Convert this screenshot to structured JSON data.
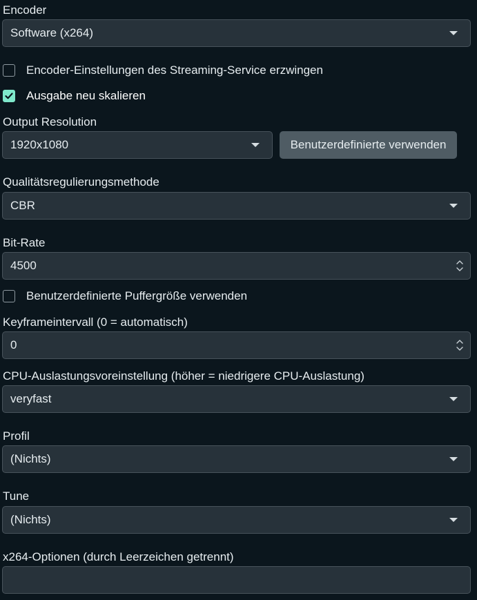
{
  "encoder": {
    "label": "Encoder",
    "value": "Software (x264)"
  },
  "enforce_streaming_settings": {
    "label": "Encoder-Einstellungen des Streaming-Service erzwingen",
    "checked": false
  },
  "rescale_output": {
    "label": "Ausgabe neu skalieren",
    "checked": true
  },
  "output_resolution": {
    "label": "Output Resolution",
    "value": "1920x1080",
    "custom_button_label": "Benutzerdefinierte verwenden"
  },
  "rate_control": {
    "label": "Qualitätsregulierungsmethode",
    "value": "CBR"
  },
  "bitrate": {
    "label": "Bit-Rate",
    "value": "4500"
  },
  "custom_buffer": {
    "label": "Benutzerdefinierte Puffergröße verwenden",
    "checked": false
  },
  "keyframe_interval": {
    "label": "Keyframeintervall (0 = automatisch)",
    "value": "0"
  },
  "cpu_preset": {
    "label": "CPU-Auslastungsvoreinstellung (höher = niedrigere CPU-Auslastung)",
    "value": "veryfast"
  },
  "profile": {
    "label": "Profil",
    "value": "(Nichts)"
  },
  "tune": {
    "label": "Tune",
    "value": "(Nichts)"
  },
  "x264_options": {
    "label": "x264-Optionen (durch Leerzeichen getrennt)",
    "value": ""
  },
  "colors": {
    "background": "#0b161d",
    "field": "#27323a",
    "accent_check": "#7fe8cb",
    "button": "#4f5c64"
  }
}
